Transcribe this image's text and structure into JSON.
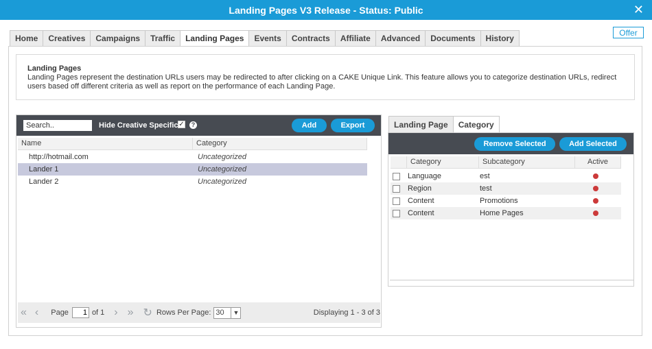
{
  "window": {
    "title": "Landing Pages V3 Release - Status: Public",
    "close": "✕"
  },
  "offer_button": "Offer",
  "main_tabs": [
    "Home",
    "Creatives",
    "Campaigns",
    "Traffic",
    "Landing Pages",
    "Events",
    "Contracts",
    "Affiliate",
    "Advanced",
    "Documents",
    "History"
  ],
  "description": {
    "title": "Landing Pages",
    "text": "Landing Pages represent the destination URLs users may be redirected to after clicking on a CAKE Unique Link. This feature allows you to categorize destination URLs, redirect users based off different criteria as well as report on the performance of each Landing Page."
  },
  "left": {
    "search_value": "Search..",
    "hide_label": "Hide Creative Specific",
    "hide_checked": "✓",
    "help": "?",
    "add_label": "Add",
    "export_label": "Export",
    "columns": [
      "Name",
      "Category"
    ],
    "rows": [
      {
        "name": "http://hotmail.com",
        "category": "Uncategorized"
      },
      {
        "name": "Lander 1",
        "category": "Uncategorized"
      },
      {
        "name": "Lander 2",
        "category": "Uncategorized"
      }
    ],
    "pager": {
      "page_label": "Page",
      "page_value": "1",
      "of_label": "of 1",
      "rows_per_page_label": "Rows Per Page:",
      "rows_per_page_value": "30",
      "displaying": "Displaying 1 - 3 of 3"
    }
  },
  "right": {
    "tabs": [
      "Landing Page",
      "Category"
    ],
    "remove_label": "Remove Selected",
    "add_label": "Add Selected",
    "columns": [
      "Category",
      "Subcategory",
      "Active"
    ],
    "rows": [
      {
        "category": "Language",
        "subcategory": "est"
      },
      {
        "category": "Region",
        "subcategory": "test"
      },
      {
        "category": "Content",
        "subcategory": "Promotions"
      },
      {
        "category": "Content",
        "subcategory": "Home Pages"
      }
    ]
  },
  "colors": {
    "accent": "#1a9bd7",
    "toolbar": "#474b52",
    "selected_row": "#c7c9dd",
    "inactive_dot": "#cc3a3a"
  }
}
